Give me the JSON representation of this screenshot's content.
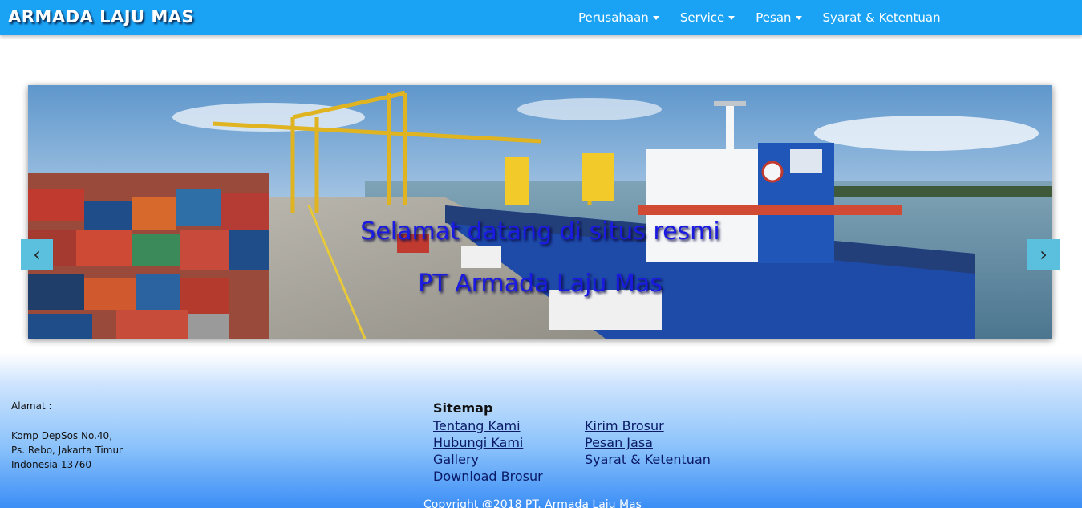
{
  "navbar": {
    "brand": "ARMADA LAJU MAS",
    "items": [
      {
        "label": "Perusahaan",
        "has_dropdown": true
      },
      {
        "label": "Service",
        "has_dropdown": true
      },
      {
        "label": "Pesan",
        "has_dropdown": true
      },
      {
        "label": "Syarat & Ketentuan",
        "has_dropdown": false
      }
    ]
  },
  "carousel": {
    "caption_line1": "Selamat datang di situs resmi",
    "caption_line2": "PT Armada Laju Mas",
    "prev_icon": "‹",
    "next_icon": "›"
  },
  "footer": {
    "address_label": "Alamat :",
    "address_lines": [
      "Komp DepSos No.40,",
      "Ps. Rebo, Jakarta Timur",
      "Indonesia 13760"
    ],
    "sitemap_title": "Sitemap",
    "sitemap_col1": [
      "Tentang Kami",
      "Hubungi Kami",
      "Gallery",
      "Download Brosur"
    ],
    "sitemap_col2": [
      "Kirim Brosur",
      "Pesan Jasa",
      "Syarat & Ketentuan"
    ],
    "copyright": "Copyright @2018 PT. Armada Laju Mas"
  },
  "colors": {
    "navbar_bg": "#1aa3f5",
    "caption_text": "#1a1ae0",
    "carousel_control_bg": "#5bc0de"
  }
}
